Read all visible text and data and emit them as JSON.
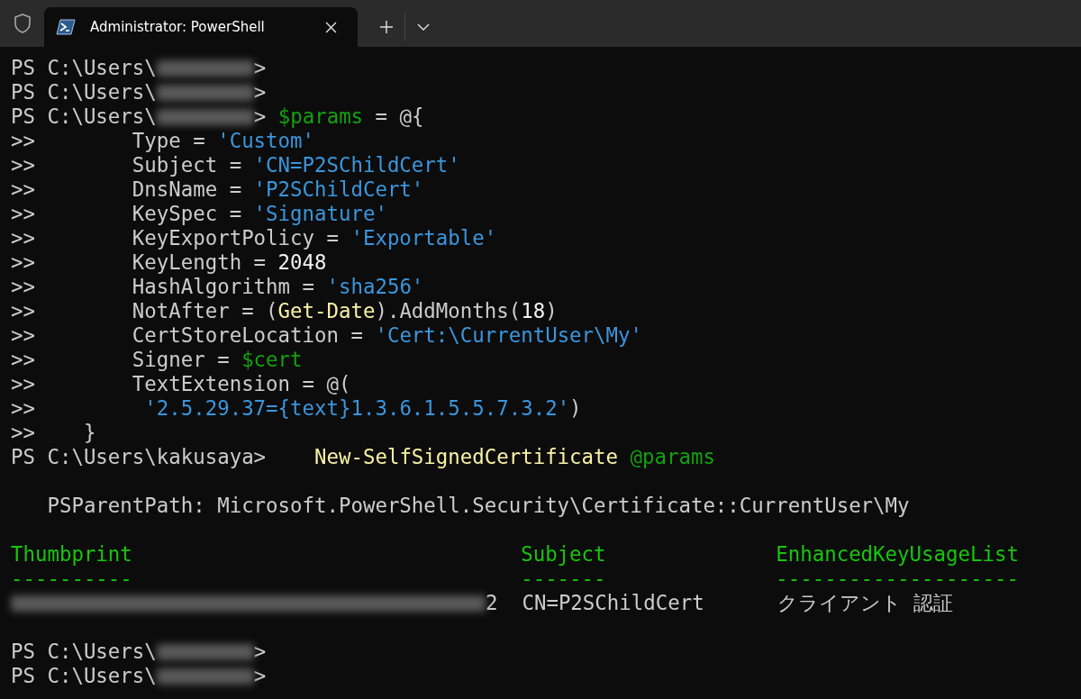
{
  "tabs": [
    {
      "title": "Administrator: PowerShell",
      "selected": true
    }
  ],
  "terminal": {
    "lines": [
      {
        "kind": "text",
        "segments": [
          {
            "kind": "plain",
            "text": "PS C:\\Users\\"
          },
          {
            "kind": "redacted-name"
          },
          {
            "kind": "plain",
            "text": ">"
          }
        ]
      },
      {
        "kind": "text",
        "segments": [
          {
            "kind": "plain",
            "text": "PS C:\\Users\\"
          },
          {
            "kind": "redacted-name"
          },
          {
            "kind": "plain",
            "text": ">"
          }
        ]
      },
      {
        "kind": "text",
        "segments": [
          {
            "kind": "plain",
            "text": "PS C:\\Users\\"
          },
          {
            "kind": "redacted-name"
          },
          {
            "kind": "plain",
            "text": "> "
          },
          {
            "kind": "variable",
            "text": "$params"
          },
          {
            "kind": "plain",
            "text": " = @{"
          }
        ]
      },
      {
        "kind": "text",
        "segments": [
          {
            "kind": "plain",
            "text": ">>        Type = "
          },
          {
            "kind": "string",
            "text": "'Custom'"
          }
        ]
      },
      {
        "kind": "text",
        "segments": [
          {
            "kind": "plain",
            "text": ">>        Subject = "
          },
          {
            "kind": "string",
            "text": "'CN=P2SChildCert'"
          }
        ]
      },
      {
        "kind": "text",
        "segments": [
          {
            "kind": "plain",
            "text": ">>        DnsName = "
          },
          {
            "kind": "string",
            "text": "'P2SChildCert'"
          }
        ]
      },
      {
        "kind": "text",
        "segments": [
          {
            "kind": "plain",
            "text": ">>        KeySpec = "
          },
          {
            "kind": "string",
            "text": "'Signature'"
          }
        ]
      },
      {
        "kind": "text",
        "segments": [
          {
            "kind": "plain",
            "text": ">>        KeyExportPolicy = "
          },
          {
            "kind": "string",
            "text": "'Exportable'"
          }
        ]
      },
      {
        "kind": "text",
        "segments": [
          {
            "kind": "plain",
            "text": ">>        KeyLength = "
          },
          {
            "kind": "number",
            "text": "2048"
          }
        ]
      },
      {
        "kind": "text",
        "segments": [
          {
            "kind": "plain",
            "text": ">>        HashAlgorithm = "
          },
          {
            "kind": "string",
            "text": "'sha256'"
          }
        ]
      },
      {
        "kind": "text",
        "segments": [
          {
            "kind": "plain",
            "text": ">>        NotAfter = ("
          },
          {
            "kind": "command",
            "text": "Get-Date"
          },
          {
            "kind": "plain",
            "text": ").AddMonths("
          },
          {
            "kind": "number",
            "text": "18"
          },
          {
            "kind": "plain",
            "text": ")"
          }
        ]
      },
      {
        "kind": "text",
        "segments": [
          {
            "kind": "plain",
            "text": ">>        CertStoreLocation = "
          },
          {
            "kind": "string",
            "text": "'Cert:\\CurrentUser\\My'"
          }
        ]
      },
      {
        "kind": "text",
        "segments": [
          {
            "kind": "plain",
            "text": ">>        Signer = "
          },
          {
            "kind": "variable",
            "text": "$cert"
          }
        ]
      },
      {
        "kind": "text",
        "segments": [
          {
            "kind": "plain",
            "text": ">>        TextExtension = @("
          }
        ]
      },
      {
        "kind": "text",
        "segments": [
          {
            "kind": "plain",
            "text": ">>         "
          },
          {
            "kind": "string",
            "text": "'2.5.29.37={text}1.3.6.1.5.5.7.3.2'"
          },
          {
            "kind": "plain",
            "text": ")"
          }
        ]
      },
      {
        "kind": "text",
        "segments": [
          {
            "kind": "plain",
            "text": ">>    }"
          }
        ]
      },
      {
        "kind": "text",
        "segments": [
          {
            "kind": "plain",
            "text": "PS C:\\Users\\kakusaya>    "
          },
          {
            "kind": "command",
            "text": "New-SelfSignedCertificate"
          },
          {
            "kind": "variable",
            "text": " @params"
          }
        ]
      },
      {
        "kind": "blank"
      },
      {
        "kind": "text",
        "segments": [
          {
            "kind": "plain",
            "text": "   PSParentPath: Microsoft.PowerShell.Security\\Certificate::CurrentUser\\My"
          }
        ]
      },
      {
        "kind": "blank"
      },
      {
        "kind": "text",
        "segments": [
          {
            "kind": "header",
            "text": "Thumbprint                                Subject              EnhancedKeyUsageList"
          }
        ]
      },
      {
        "kind": "text",
        "segments": [
          {
            "kind": "header",
            "text": "----------                                -------              --------------------"
          }
        ]
      },
      {
        "kind": "text",
        "segments": [
          {
            "kind": "redacted-hash"
          },
          {
            "kind": "plain",
            "text": "2  CN=P2SChildCert      クライアント 認証"
          }
        ]
      },
      {
        "kind": "blank"
      },
      {
        "kind": "text",
        "segments": [
          {
            "kind": "plain",
            "text": "PS C:\\Users\\"
          },
          {
            "kind": "redacted-name"
          },
          {
            "kind": "plain",
            "text": ">"
          }
        ]
      },
      {
        "kind": "text",
        "segments": [
          {
            "kind": "plain",
            "text": "PS C:\\Users\\"
          },
          {
            "kind": "redacted-name"
          },
          {
            "kind": "plain",
            "text": ">"
          }
        ]
      }
    ]
  }
}
